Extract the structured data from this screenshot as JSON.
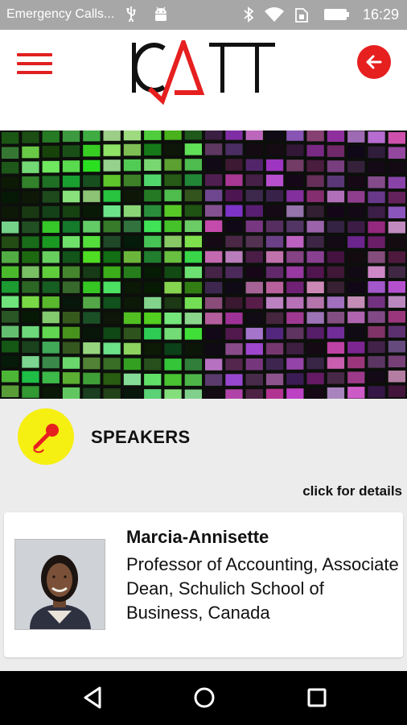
{
  "status_bar": {
    "carrier": "Emergency Calls...",
    "time": "16:29",
    "icons": [
      "usb-icon",
      "android-icon",
      "bluetooth-icon",
      "wifi-icon",
      "sim-icon",
      "battery-icon"
    ]
  },
  "app_bar": {
    "logo_text": "ICATT",
    "menu_icon": "hamburger-menu-icon",
    "back_icon": "back-arrow-icon"
  },
  "section": {
    "icon": "microphone-icon",
    "title": "SPEAKERS"
  },
  "hint": "click for details",
  "speakers": [
    {
      "name": "Marcia-Annisette",
      "role": "Professor of Accounting, Associate Dean, Schulich School of Business, Canada"
    }
  ],
  "nav_bar": {
    "icons": [
      "back-triangle-icon",
      "home-circle-icon",
      "recents-square-icon"
    ]
  },
  "colors": {
    "accent": "#e61f1f",
    "icon_circle": "#f6ef12",
    "status_bar": "#a7a7a7",
    "background": "#ececec"
  }
}
